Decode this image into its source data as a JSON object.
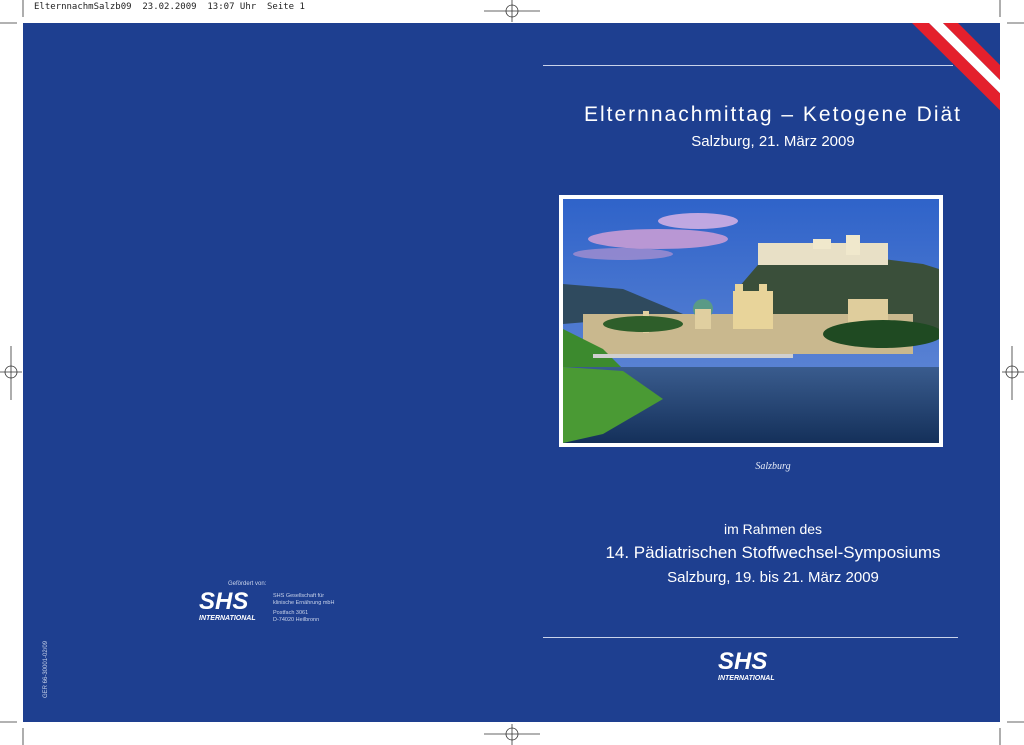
{
  "slug": "ElternnachmSalzb09  23.02.2009  13:07 Uhr  Seite 1",
  "front": {
    "title": "Elternnachmittag – Ketogene Diät",
    "subtitle": "Salzburg, 21. März 2009",
    "photo_caption": "Salzburg",
    "context_line": "im Rahmen des",
    "symposium": "14. Pädiatrischen Stoffwechsel-Symposiums",
    "symposium_dates": "Salzburg, 19. bis 21. März 2009"
  },
  "back": {
    "sponsor_label": "Gefördert von:",
    "logo_text": "SHS",
    "logo_sub": "INTERNATIONAL",
    "address": [
      "SHS Gesellschaft für",
      "klinische Ernährung mbH",
      "Postfach 3061",
      "D-74020 Heilbronn"
    ],
    "code": "GER 66-30001-02/09"
  },
  "colors": {
    "panel": "#1e3f90",
    "flag_red": "#e4202c",
    "flag_white": "#ffffff"
  }
}
